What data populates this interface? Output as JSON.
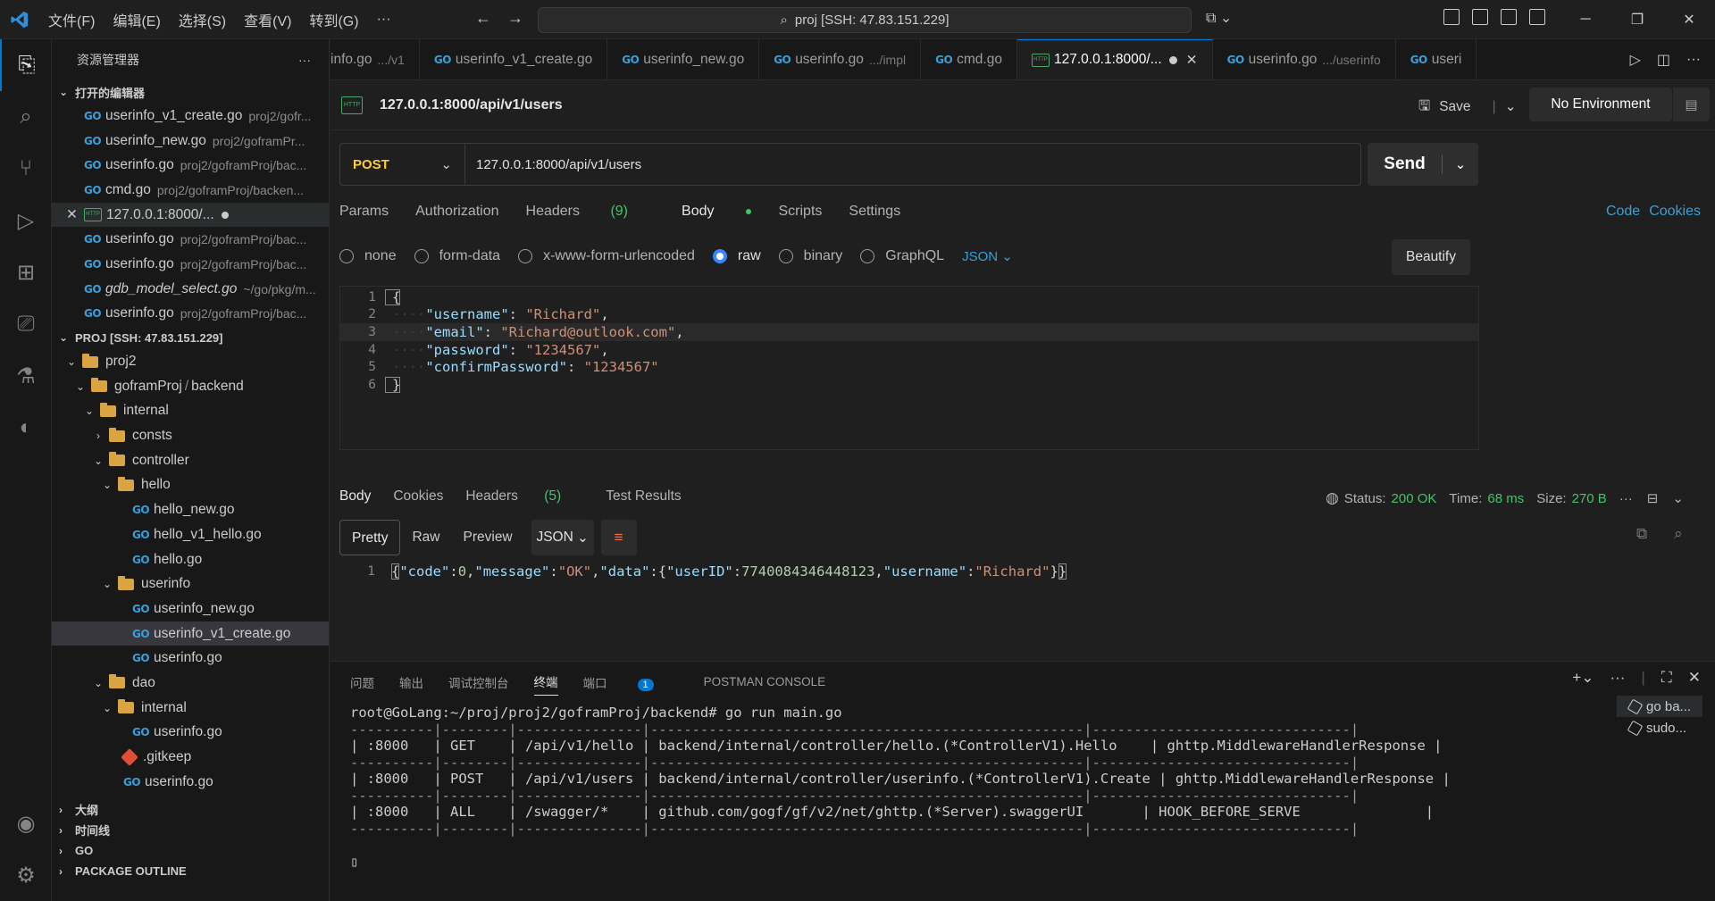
{
  "titlebar": {
    "menu": [
      "文件(F)",
      "编辑(E)",
      "选择(S)",
      "查看(V)",
      "转到(G)",
      "···"
    ],
    "search": "proj [SSH: 47.83.151.229]"
  },
  "sidebar": {
    "title": "资源管理器",
    "open_editors_label": "打开的编辑器",
    "open_editors": [
      {
        "name": "userinfo_v1_create.go",
        "path": "proj2/gofr..."
      },
      {
        "name": "userinfo_new.go",
        "path": "proj2/goframPr..."
      },
      {
        "name": "userinfo.go",
        "path": "proj2/goframProj/bac..."
      },
      {
        "name": "cmd.go",
        "path": "proj2/goframProj/backen..."
      },
      {
        "name": "127.0.0.1:8000/...",
        "path": ""
      },
      {
        "name": "userinfo.go",
        "path": "proj2/goframProj/bac..."
      },
      {
        "name": "userinfo.go",
        "path": "proj2/goframProj/bac..."
      },
      {
        "name": "gdb_model_select.go",
        "path": "~/go/pkg/m..."
      },
      {
        "name": "userinfo.go",
        "path": "proj2/goframProj/bac..."
      }
    ],
    "project_label": "PROJ [SSH: 47.83.151.229]",
    "tree": {
      "proj2": "proj2",
      "gofram": "goframProj",
      "backend": "backend",
      "internal": "internal",
      "consts": "consts",
      "controller": "controller",
      "hello": "hello",
      "hello_new": "hello_new.go",
      "hello_v1_hello": "hello_v1_hello.go",
      "hello_go": "hello.go",
      "userinfo": "userinfo",
      "userinfo_new": "userinfo_new.go",
      "userinfo_v1_create": "userinfo_v1_create.go",
      "userinfo_go": "userinfo.go",
      "dao": "dao",
      "dao_internal": "internal",
      "dao_internal_userinfo": "userinfo.go",
      "gitkeep": ".gitkeep",
      "dao_userinfo": "userinfo.go"
    },
    "bottom_sections": [
      "大纲",
      "时间线",
      "GO",
      "PACKAGE OUTLINE"
    ]
  },
  "tabs": [
    {
      "name": "info.go",
      "desc": ".../v1"
    },
    {
      "name": "userinfo_v1_create.go",
      "desc": ""
    },
    {
      "name": "userinfo_new.go",
      "desc": ""
    },
    {
      "name": "userinfo.go",
      "desc": ".../impl"
    },
    {
      "name": "cmd.go",
      "desc": ""
    },
    {
      "name": "127.0.0.1:8000/...",
      "desc": ""
    },
    {
      "name": "userinfo.go",
      "desc": ".../userinfo"
    },
    {
      "name": "useri",
      "desc": ""
    }
  ],
  "request": {
    "name": "127.0.0.1:8000/api/v1/users",
    "save_label": "Save",
    "environment": "No Environment",
    "method": "POST",
    "url": "127.0.0.1:8000/api/v1/users",
    "send_label": "Send",
    "tabs": {
      "params": "Params",
      "authorization": "Authorization",
      "headers": "Headers",
      "headers_count": "(9)",
      "body": "Body",
      "scripts": "Scripts",
      "settings": "Settings"
    },
    "code_link": "Code",
    "cookies_link": "Cookies",
    "body_types": [
      "none",
      "form-data",
      "x-www-form-urlencoded",
      "raw",
      "binary",
      "GraphQL"
    ],
    "body_format": "JSON",
    "beautify_label": "Beautify",
    "body_lines": [
      {
        "n": "1"
      },
      {
        "n": "2",
        "key": "\"username\"",
        "val": "\"Richard\""
      },
      {
        "n": "3",
        "key": "\"email\"",
        "val": "\"Richard@outlook.com\""
      },
      {
        "n": "4",
        "key": "\"password\"",
        "val": "\"1234567\""
      },
      {
        "n": "5",
        "key": "\"confirmPassword\"",
        "val": "\"1234567\""
      },
      {
        "n": "6"
      }
    ]
  },
  "response": {
    "tabs": {
      "body": "Body",
      "cookies": "Cookies",
      "headers": "Headers",
      "headers_count": "(5)",
      "test_results": "Test Results"
    },
    "status_label": "Status:",
    "status": "200 OK",
    "time_label": "Time:",
    "time": "68 ms",
    "size_label": "Size:",
    "size": "270 B",
    "views": [
      "Pretty",
      "Raw",
      "Preview"
    ],
    "format": "JSON",
    "line_no": "1",
    "code": 0,
    "message": "OK",
    "user_id": 7740084346448123,
    "username": "Richard"
  },
  "panel": {
    "tabs": [
      "问题",
      "输出",
      "调试控制台",
      "终端",
      "端口",
      "POSTMAN CONSOLE"
    ],
    "ports_badge": "1",
    "terminal_lines": [
      "root@GoLang:~/proj/proj2/goframProj/backend# go run main.go",
      "----------|--------|---------------|----------------------------------------------------|-------------------------------|",
      "| :8000   | GET    | /api/v1/hello | backend/internal/controller/hello.(*ControllerV1).Hello    | ghttp.MiddlewareHandlerResponse |",
      "----------|--------|---------------|----------------------------------------------------|-------------------------------|",
      "| :8000   | POST   | /api/v1/users | backend/internal/controller/userinfo.(*ControllerV1).Create | ghttp.MiddlewareHandlerResponse |",
      "----------|--------|---------------|----------------------------------------------------|-------------------------------|",
      "| :8000   | ALL    | /swagger/*    | github.com/gogf/gf/v2/net/ghttp.(*Server).swaggerUI       | HOOK_BEFORE_SERVE               |",
      "----------|--------|---------------|----------------------------------------------------|-------------------------------|",
      "",
      "▯"
    ],
    "terminal_instances": [
      "go ba...",
      "sudo..."
    ]
  }
}
